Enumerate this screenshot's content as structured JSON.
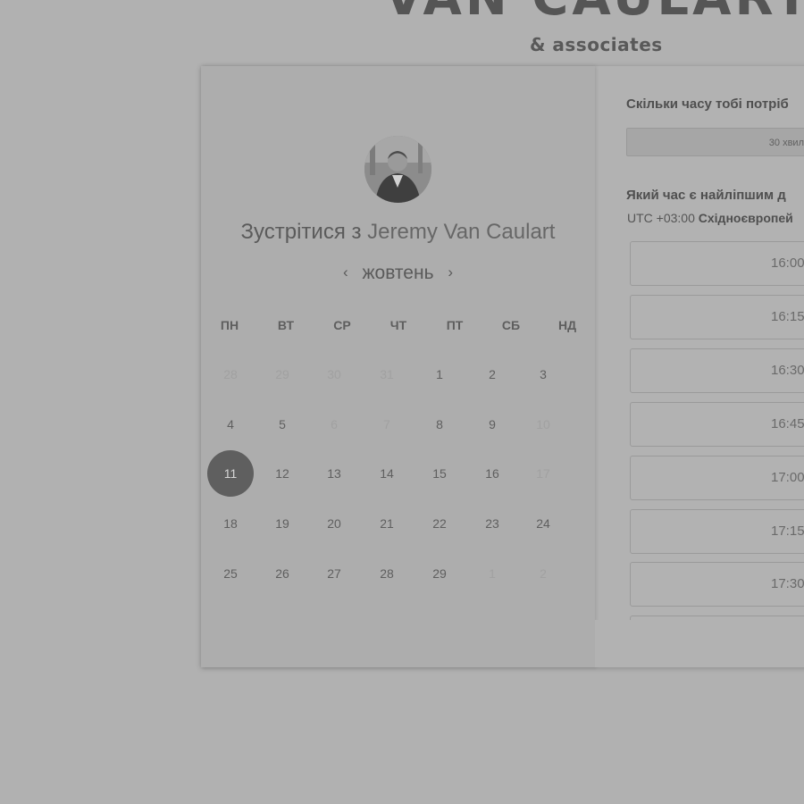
{
  "header": {
    "logo_text": "VAN CAULART",
    "logo_sub": "& associates"
  },
  "host": {
    "title_prefix": "Зустрітися з",
    "name": "Jeremy Van Caulart"
  },
  "calendar": {
    "month": "жовтень",
    "prev_icon": "chevron-left-icon",
    "next_icon": "chevron-right-icon",
    "weekdays": [
      "ПН",
      "ВТ",
      "СР",
      "ЧТ",
      "ПТ",
      "СБ",
      "НД"
    ],
    "weeks": [
      [
        "28",
        "29",
        "30",
        "31",
        "1",
        "2",
        "3"
      ],
      [
        "4",
        "5",
        "6",
        "7",
        "8",
        "9",
        "10"
      ],
      [
        "11",
        "12",
        "13",
        "14",
        "15",
        "16",
        "17"
      ],
      [
        "18",
        "19",
        "20",
        "21",
        "22",
        "23",
        "24"
      ],
      [
        "25",
        "26",
        "27",
        "28",
        "29",
        "1",
        "2"
      ]
    ],
    "selected_day": "11"
  },
  "booking": {
    "duration_question": "Скільки часу тобі потріб",
    "duration_value": "30 хвил",
    "time_question": "Який час є найліпшим д",
    "timezone_offset": "UTC +03:00",
    "timezone_name": "Східноєвропей",
    "slots": [
      "16:00",
      "16:15",
      "16:30",
      "16:45",
      "17:00",
      "17:15",
      "17:30"
    ]
  },
  "colors": {
    "selected_day_bg": "#5f5f5f",
    "background": "#b1b1b1"
  }
}
